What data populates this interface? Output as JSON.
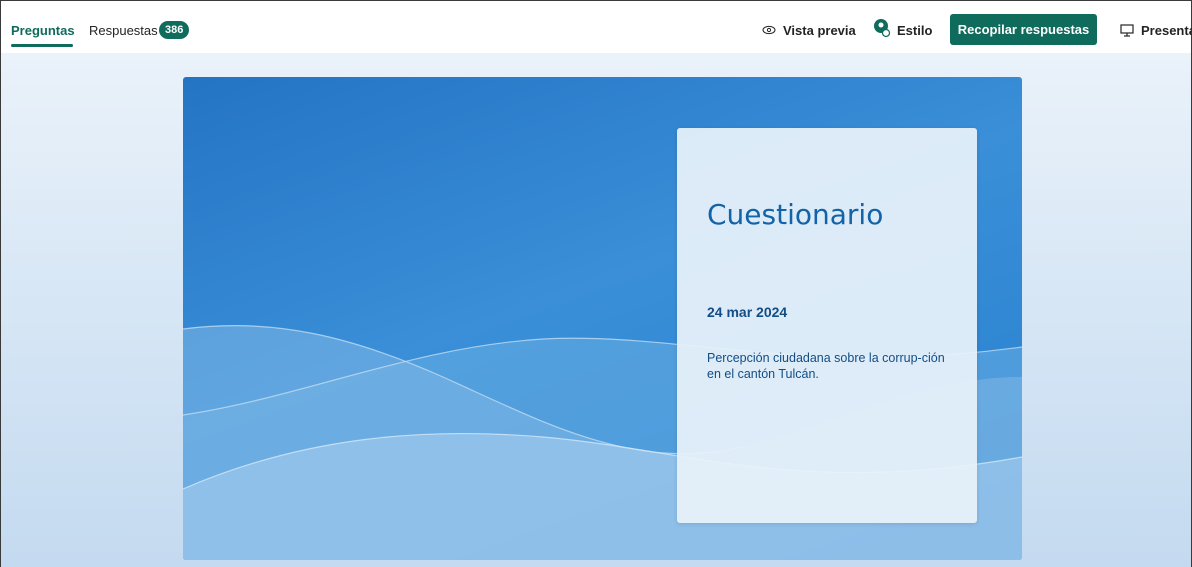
{
  "tabs": {
    "questions": "Preguntas",
    "responses": "Respuestas",
    "responses_count": "386"
  },
  "toolbar": {
    "preview_label": "Vista previa",
    "preview_icon": "eye-icon",
    "style_label": "Estilo",
    "style_icon": "palette-icon",
    "collect_label": "Recopilar respuestas",
    "present_label": "Presentar",
    "present_icon": "monitor-icon"
  },
  "form": {
    "title": "Cuestionario",
    "date": "24 mar 2024",
    "description": "Percepción ciudadana sobre la corrup-ción en el cantón Tulcán."
  },
  "colors": {
    "accent": "#0f6b5b",
    "card_text": "#124d85",
    "cover_blue": "#2f86d2"
  }
}
